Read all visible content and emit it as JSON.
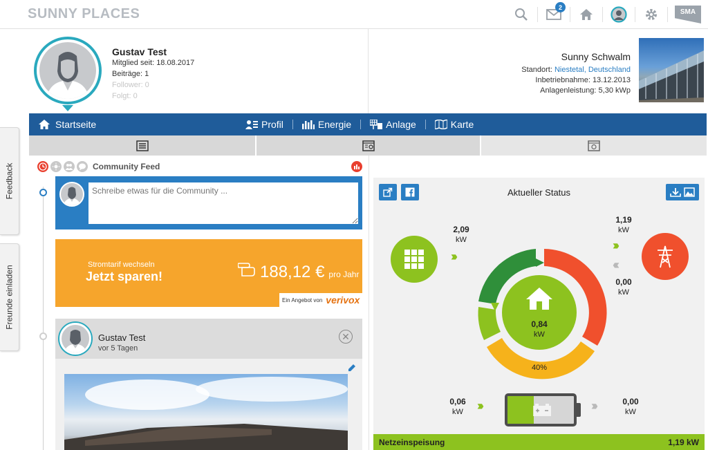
{
  "app": {
    "logo": "SUNNY PLACES",
    "notifications_count": "2",
    "brand": "SMA"
  },
  "sidetabs": {
    "feedback": "Feedback",
    "invite": "Freunde einladen"
  },
  "profile": {
    "name": "Gustav Test",
    "member_since": "Mitglied seit: 18.08.2017",
    "posts": "Beiträge: 1",
    "followers": "Follower: 0",
    "following": "Folgt: 0"
  },
  "plant": {
    "name": "Sunny Schwalm",
    "location_label": "Standort: ",
    "location_link": "Niestetal, Deutschland",
    "commissioning": "Inbetriebnahme: 13.12.2013",
    "power": "Anlagenleistung: 5,30 kWp"
  },
  "nav": {
    "home": "Startseite",
    "items": [
      {
        "label": "Profil",
        "icon": "profile-icon"
      },
      {
        "label": "Energie",
        "icon": "energy-chart-icon"
      },
      {
        "label": "Anlage",
        "icon": "plant-icon"
      },
      {
        "label": "Karte",
        "icon": "map-icon"
      }
    ]
  },
  "feed": {
    "title": "Community Feed",
    "compose_placeholder": "Schreibe etwas für die Community ...",
    "ad": {
      "subtitle": "Stromtarif wechseln",
      "headline": "Jetzt sparen!",
      "price": "188,12 €",
      "price_unit": "pro Jahr",
      "provider_prefix": "Ein Angebot von",
      "provider": "verivox"
    },
    "post": {
      "author": "Gustav Test",
      "time": "vor 5 Tagen"
    }
  },
  "status": {
    "title": "Aktueller Status",
    "pv_value": "2,09",
    "pv_unit": "kW",
    "grid_in_value": "1,19",
    "grid_in_unit": "kW",
    "grid_out_value": "0,00",
    "grid_out_unit": "kW",
    "house_value": "0,84",
    "house_unit": "kW",
    "battery_percent_label": "40%",
    "battery_level": 0.4,
    "battery_in_value": "0,06",
    "battery_in_unit": "kW",
    "battery_out_value": "0,00",
    "battery_out_unit": "kW",
    "footer_label": "Netzeinspeisung",
    "footer_value": "1,19 kW"
  },
  "colors": {
    "accent": "#2a7ec3",
    "nav": "#1f5c9a",
    "green": "#8dc21f",
    "orange": "#f6a52c",
    "red": "#f0502d",
    "yellow": "#f6b21b"
  }
}
